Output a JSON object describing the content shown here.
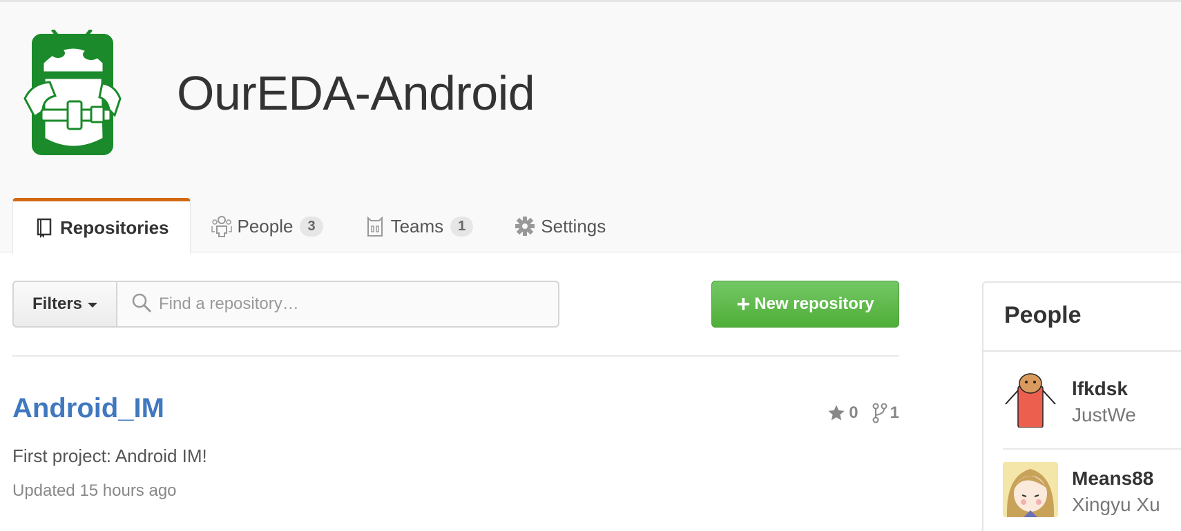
{
  "org": {
    "name": "OurEDA-Android",
    "avatar_icon": "android-robot-logo"
  },
  "tabs": [
    {
      "label": "Repositories",
      "icon": "repo-book-icon",
      "selected": true
    },
    {
      "label": "People",
      "icon": "people-icon",
      "count": "3"
    },
    {
      "label": "Teams",
      "icon": "teams-icon",
      "count": "1"
    },
    {
      "label": "Settings",
      "icon": "gear-icon"
    }
  ],
  "filters": {
    "label": "Filters",
    "search_placeholder": "Find a repository…"
  },
  "new_repo_label": "New repository",
  "repositories": [
    {
      "name": "Android_IM",
      "description": "First project: Android IM!",
      "updated": "Updated 15 hours ago",
      "stars": "0",
      "forks": "1"
    }
  ],
  "people": {
    "title": "People",
    "members": [
      {
        "login": "lfkdsk",
        "name": "JustWe"
      },
      {
        "login": "Means88",
        "name": "Xingyu Xu"
      }
    ]
  },
  "colors": {
    "accent_tab": "#d26911",
    "link": "#4078c0",
    "button_green": "#5cb84a",
    "logo_green": "#1a8a2a"
  }
}
